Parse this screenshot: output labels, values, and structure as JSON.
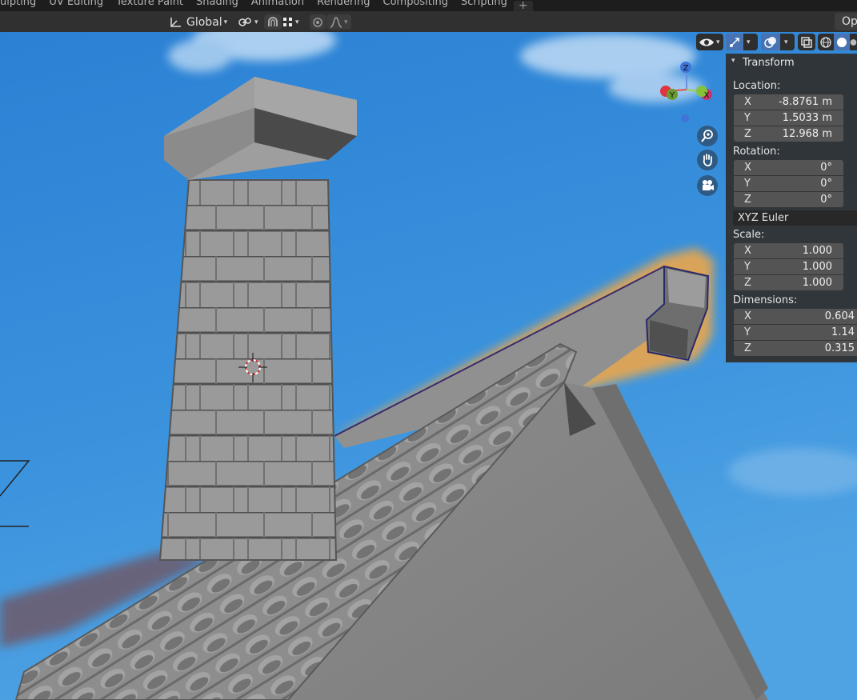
{
  "tabs": [
    "ulpting",
    "UV Editing",
    "Texture Paint",
    "Shading",
    "Animation",
    "Rendering",
    "Compositing",
    "Scripting"
  ],
  "tab_add": "+",
  "header": {
    "transform_orientation": "Global",
    "options_label": "Op"
  },
  "gizmo": {
    "x": "X",
    "y": "Y",
    "z": "Z"
  },
  "icons": {
    "orientation": "transform-orientation-icon",
    "pivot": "pivot-point-icon",
    "snap": "snap-icon",
    "snap_increment": "snap-grid-icon",
    "proportional": "proportional-editing-icon",
    "falloff": "falloff-curve-icon",
    "visibility": "visibility-icon",
    "gizmos": "gizmo-icon",
    "overlays": "overlay-icon",
    "xray": "xray-icon",
    "wireframe": "wireframe-shading-icon",
    "solid": "solid-shading-icon",
    "zoom": "zoom-icon",
    "pan": "hand-pan-icon",
    "camera": "camera-view-icon"
  },
  "transform_panel": {
    "title": "Transform",
    "location_label": "Location:",
    "location": [
      {
        "axis": "X",
        "value": "-8.8761 m"
      },
      {
        "axis": "Y",
        "value": "1.5033 m"
      },
      {
        "axis": "Z",
        "value": "12.968 m"
      }
    ],
    "rotation_label": "Rotation:",
    "rotation": [
      {
        "axis": "X",
        "value": "0°"
      },
      {
        "axis": "Y",
        "value": "0°"
      },
      {
        "axis": "Z",
        "value": "0°"
      }
    ],
    "rotation_mode": "XYZ Euler",
    "scale_label": "Scale:",
    "scale": [
      {
        "axis": "X",
        "value": "1.000"
      },
      {
        "axis": "Y",
        "value": "1.000"
      },
      {
        "axis": "Z",
        "value": "1.000"
      }
    ],
    "dimensions_label": "Dimensions:",
    "dimensions": [
      {
        "axis": "X",
        "value": "0.604"
      },
      {
        "axis": "Y",
        "value": "1.14"
      },
      {
        "axis": "Z",
        "value": "0.315"
      }
    ]
  },
  "colors": {
    "sky": "#2f86d6",
    "roof": "#8a8a8a",
    "selected_outline": "#f5a040",
    "accent_button": "#4772b3"
  }
}
